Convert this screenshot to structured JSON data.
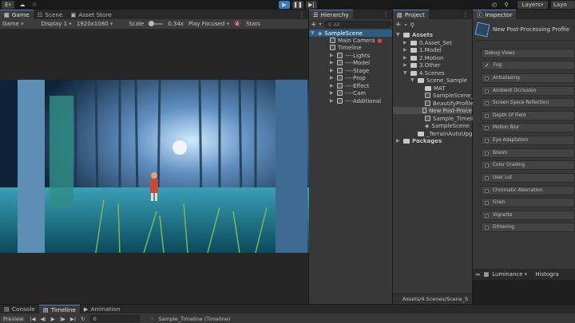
{
  "topbar": {
    "account": "E",
    "layers": "Layers",
    "layout": "Layo"
  },
  "game": {
    "tabs": [
      "Game",
      "Scene",
      "Asset Store"
    ],
    "display_mode": "Game",
    "display": "Display 1",
    "resolution": "1920x1080",
    "scale_label": "Scale",
    "scale_value": "0.34x",
    "play_mode": "Play Focused",
    "stats": "Stats"
  },
  "hierarchy": {
    "title": "Hierarchy",
    "add": "+",
    "search_placeholder": "All",
    "scene": "SampleScene",
    "items": [
      "Main Camera",
      "Timeline",
      "----Lights",
      "----Model",
      "----Stage",
      "----Prop",
      "----Effect",
      "----Cam",
      "----Additional"
    ]
  },
  "project": {
    "title": "Project",
    "add": "+",
    "tree": [
      "Assets",
      "0.Asset_Set",
      "1.Model",
      "2.Motion",
      "3.Other",
      "4.Scenes",
      "Scene_Sample",
      "MAT",
      "SampleScene_P",
      "BeautifyProfile",
      "New Post-Proce",
      "Sample_Timelin",
      "SampleScene",
      "_TerrainAutoUpgrade",
      "Packages"
    ],
    "path": "Assets/4.Scenes/Scene_S"
  },
  "inspector": {
    "title": "Inspector",
    "object_name": "New Post-Processing Profile",
    "effects": [
      "Debug Views",
      "Fog",
      "Antialiasing",
      "Ambient Occlusion",
      "Screen Space Reflection",
      "Depth Of Field",
      "Motion Blur",
      "Eye Adaptation",
      "Bloom",
      "Color Grading",
      "User Lut",
      "Chromatic Aberration",
      "Grain",
      "Vignette",
      "Dithering"
    ],
    "preview_mode": "Luminance",
    "histogram": "Histogra"
  },
  "bottom": {
    "tabs": [
      "Console",
      "Timeline",
      "Animation"
    ],
    "preview": "Preview",
    "frame": "0",
    "timeline_asset": "Sample_Timeline (Timeline)"
  }
}
